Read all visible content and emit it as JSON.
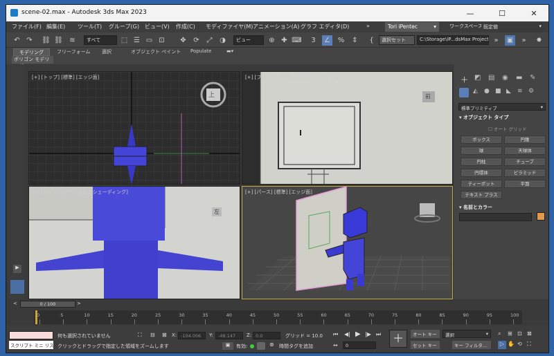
{
  "window": {
    "title": "scene-02.max - Autodesk 3ds Max 2023"
  },
  "menu": [
    "ファイル(F)",
    "編集(E)",
    "ツール(T)",
    "グループ(G)",
    "ビュー(V)",
    "作成(C)",
    "モディファイヤ(M)",
    "アニメーション(A)",
    "グラフ エディタ(D)"
  ],
  "menu_more": "»",
  "user": "Tori iPentec",
  "workspace_label": "ワークスペース:",
  "workspace_value": "既定値",
  "toolbar": {
    "filter": "すべて",
    "view": "ビュー",
    "selset": "選択セット",
    "path": "C:\\Storage\\iP...dsMax Project"
  },
  "ribbon_tabs": [
    "モデリング",
    "フリーフォーム",
    "選択",
    "オブジェクト ペイント",
    "Populate"
  ],
  "poly_label": "ポリゴン モデリング",
  "viewports": {
    "top": "[+] [トップ] [標準] [エッジ面]",
    "front": "[+] [フロント] [標準] [既定のシェーディング]",
    "left": "[+] [レフト] [標準] [既定のシェーディング]",
    "persp": "[+] [パース] [標準] [エッジ面]"
  },
  "viewcube": {
    "top": "上",
    "front": "前",
    "left": "左"
  },
  "cmd": {
    "dropdown": "標準プリミティブ",
    "objtype": "オブジェクト タイプ",
    "autogrid": "オート グリッド",
    "buttons": [
      "ボックス",
      "円錐",
      "球",
      "天球体",
      "円柱",
      "チューブ",
      "円環体",
      "ピラミッド",
      "ティーポット",
      "平面",
      "テキスト プラス"
    ],
    "namecolor": "名前とカラー",
    "color": "#e39a4f"
  },
  "timeline": {
    "frame": "0 / 100",
    "ticks": [
      "0",
      "5",
      "10",
      "15",
      "20",
      "25",
      "30",
      "35",
      "40",
      "45",
      "50",
      "55",
      "60",
      "65",
      "70",
      "75",
      "80",
      "85",
      "90",
      "95",
      "100"
    ]
  },
  "status": {
    "script": "スクリプト ミニ リス",
    "none_selected": "何も選択されていません",
    "hint": "クリックとドラッグで指定した領域をズームします",
    "x_label": "X:",
    "x": "-104.006",
    "y_label": "Y:",
    "y": "-48.147",
    "z_label": "Z:",
    "z": "0.0",
    "grid": "グリッド = 10.0",
    "enabled": "有効:",
    "addtag": "時間タグを追加",
    "autokey": "オート キー",
    "setkey": "セット キー",
    "selection": "選択",
    "keyfilter": "キー フィルタ...",
    "frame_value": "0"
  }
}
